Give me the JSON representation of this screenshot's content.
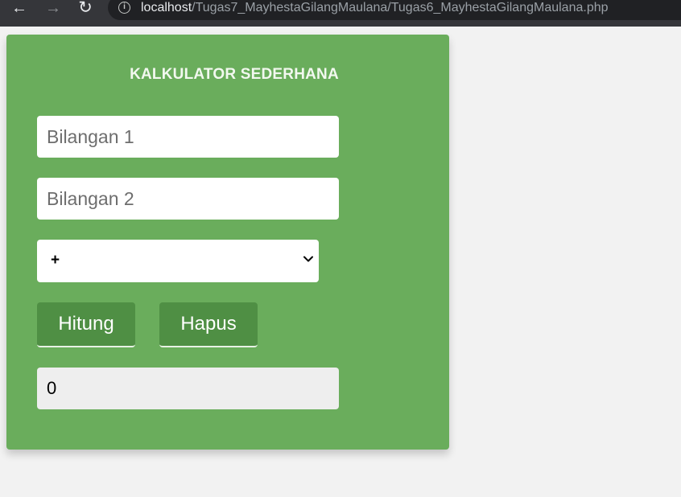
{
  "browser": {
    "url_host": "localhost",
    "url_path": "/Tugas7_MayhestaGilangMaulana/Tugas6_MayhestaGilangMaulana.php",
    "icons": [
      "back-arrow-icon",
      "forward-arrow-icon",
      "reload-icon",
      "info-icon"
    ]
  },
  "calculator": {
    "title": "KALKULATOR SEDERHANA",
    "input1_placeholder": "Bilangan 1",
    "input2_placeholder": "Bilangan 2",
    "operator_selected": "+",
    "hitung_label": "Hitung",
    "hapus_label": "Hapus",
    "result": "0"
  },
  "colors": {
    "card": "#6aad5c",
    "button": "#4f8f44",
    "page_background": "#f2f2f2",
    "result_background": "#eeeeee"
  }
}
